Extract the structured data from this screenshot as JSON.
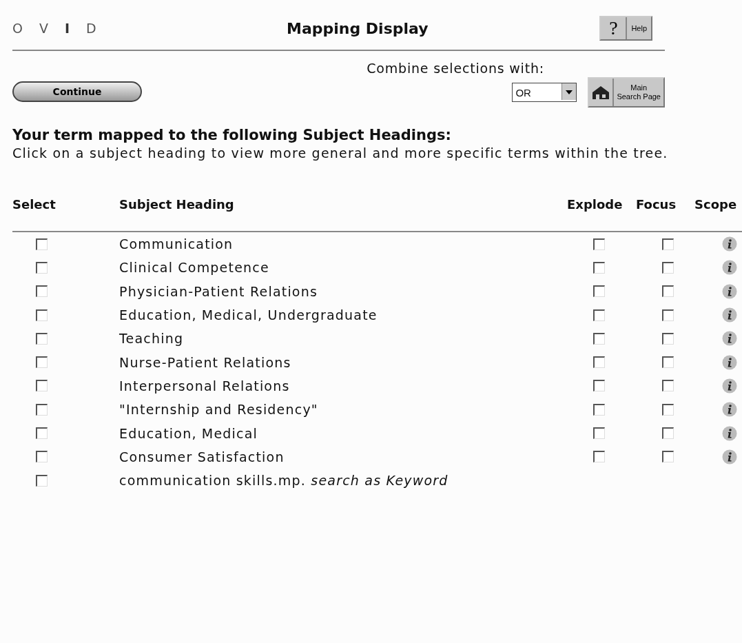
{
  "logo": [
    "O",
    "V",
    "I",
    "D"
  ],
  "title": "Mapping Display",
  "help": {
    "icon_text": "?",
    "label": "Help"
  },
  "continue_button": "Continue",
  "combine": {
    "label": "Combine selections with:",
    "value": "OR"
  },
  "main_search_button": {
    "line1": "Main",
    "line2": "Search Page"
  },
  "heading": "Your term mapped to the following Subject Headings:",
  "instructions": "Click on a subject heading to view more general and more specific terms within the tree.",
  "columns": [
    "Select",
    "Subject Heading",
    "Explode",
    "Focus",
    "Scope"
  ],
  "rows": [
    {
      "kind": "heading",
      "label": "Communication",
      "selected": false,
      "explode": false,
      "focus": false
    },
    {
      "kind": "heading",
      "label": "Clinical Competence",
      "selected": false,
      "explode": false,
      "focus": false
    },
    {
      "kind": "heading",
      "label": "Physician-Patient Relations",
      "selected": false,
      "explode": false,
      "focus": false
    },
    {
      "kind": "heading",
      "label": "Education, Medical, Undergraduate",
      "selected": false,
      "explode": false,
      "focus": false
    },
    {
      "kind": "heading",
      "label": "Teaching",
      "selected": false,
      "explode": false,
      "focus": false
    },
    {
      "kind": "heading",
      "label": "Nurse-Patient Relations",
      "selected": false,
      "explode": false,
      "focus": false
    },
    {
      "kind": "heading",
      "label": "Interpersonal Relations",
      "selected": false,
      "explode": false,
      "focus": false
    },
    {
      "kind": "heading",
      "label": "\"Internship and Residency\"",
      "selected": false,
      "explode": false,
      "focus": false
    },
    {
      "kind": "heading",
      "label": "Education, Medical",
      "selected": false,
      "explode": false,
      "focus": false
    },
    {
      "kind": "heading",
      "label": "Consumer Satisfaction",
      "selected": false,
      "explode": false,
      "focus": false
    },
    {
      "kind": "keyword",
      "label": "communication skills.mp. *search as Keyword*",
      "selected": false
    }
  ]
}
